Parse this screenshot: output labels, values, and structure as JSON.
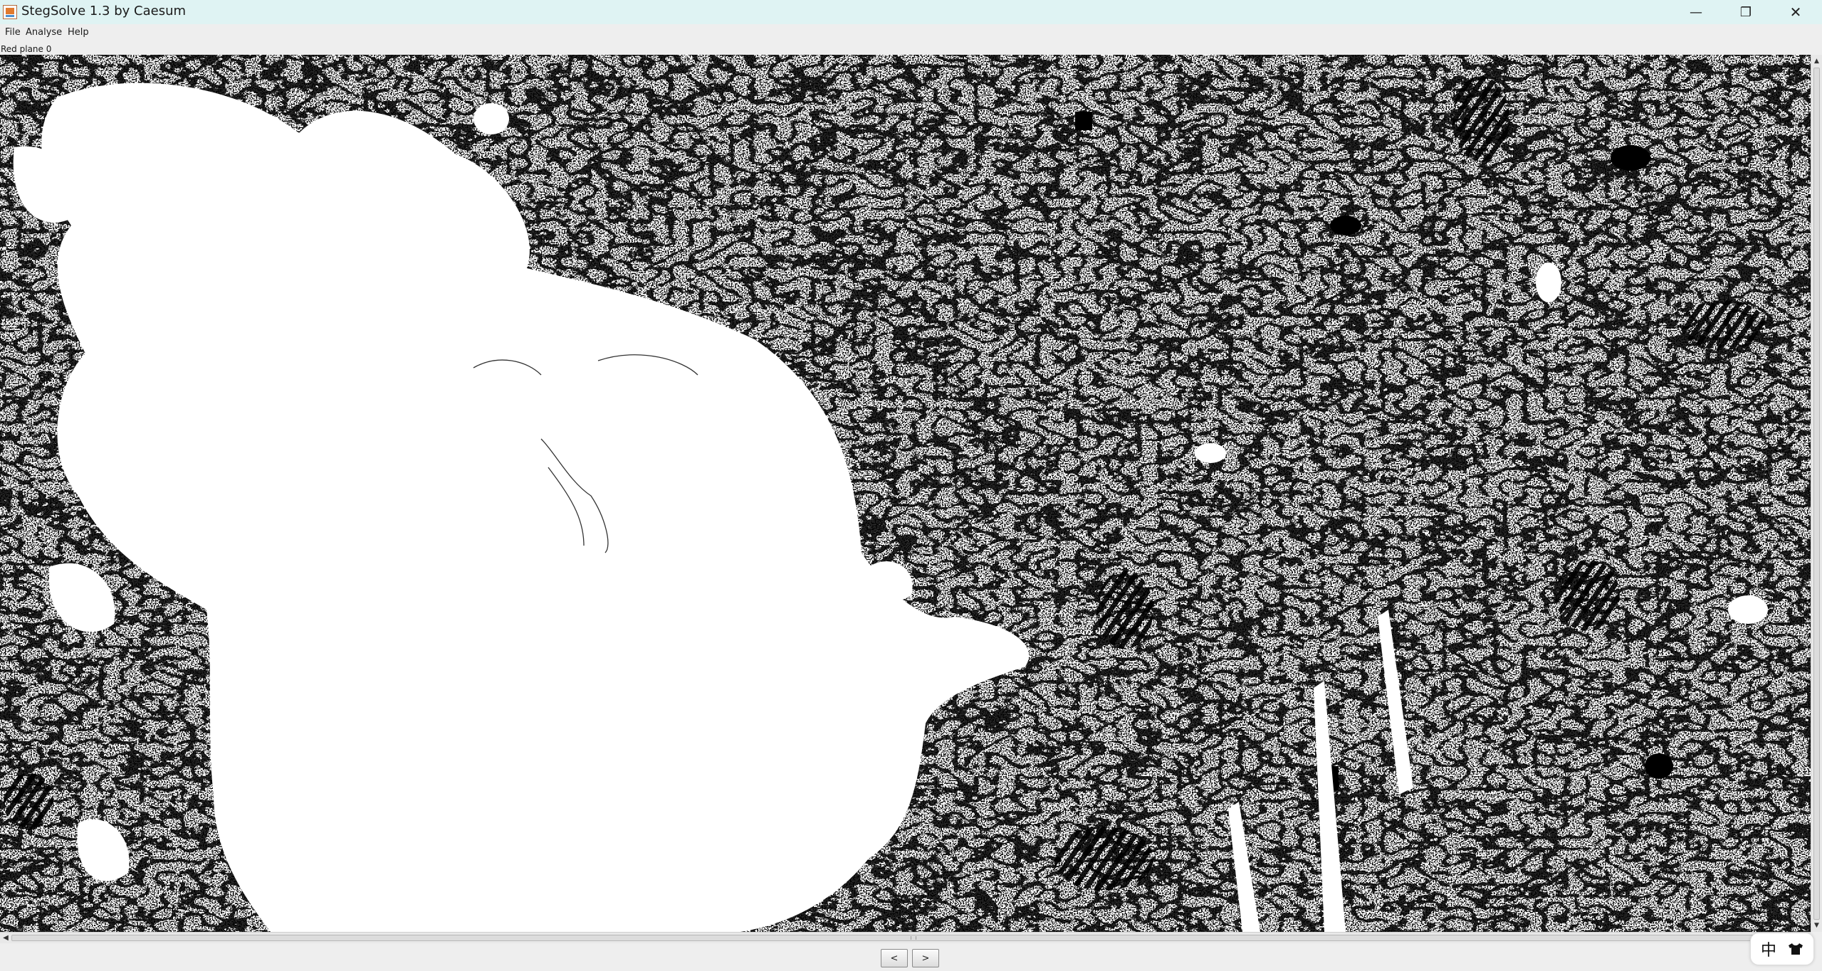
{
  "window": {
    "title": "StegSolve 1.3 by Caesum",
    "controls": {
      "minimize": "—",
      "maximize": "❐",
      "close": "✕"
    }
  },
  "menu": {
    "file": "File",
    "analyse": "Analyse",
    "help": "Help"
  },
  "plane_label": "Red plane 0",
  "image": {
    "description_icon": "bitplane-noise-image"
  },
  "scroll": {
    "up": "▲",
    "down": "▼",
    "left": "◀",
    "right": "▶"
  },
  "nav": {
    "prev": "<",
    "next": ">"
  },
  "ime": {
    "char": "中"
  },
  "colors": {
    "titlebar": "#dff3f3",
    "chrome": "#eeeeee"
  }
}
